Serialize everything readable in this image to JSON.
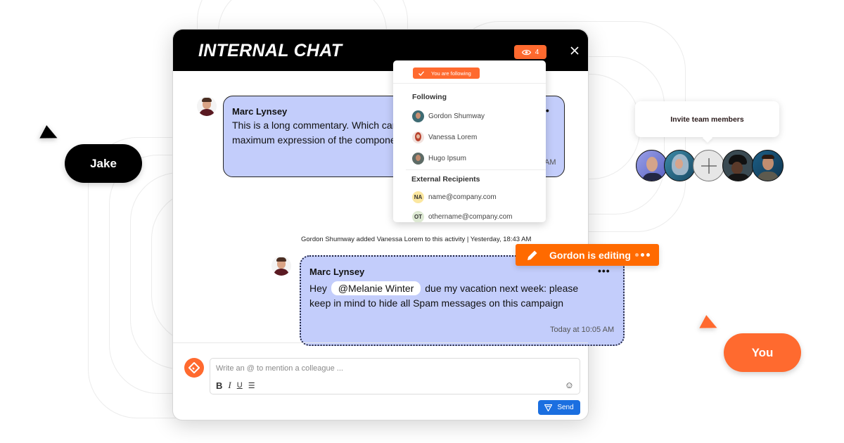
{
  "cursors": {
    "jake": {
      "label": "Jake",
      "color": "#000000"
    },
    "you": {
      "label": "You",
      "color": "#ff6a2f"
    }
  },
  "chat": {
    "title": "INTERNAL CHAT",
    "viewers_count": "4",
    "close_icon": "close-icon",
    "messages": [
      {
        "author": "Marc Lynsey",
        "text": "This is a long commentary. Which carries the maximum expression of the component.",
        "text_visible_line1": "This is a long commentary. Which carrie",
        "text_visible_line2": "maximum expression of the component.",
        "time_visible": "AM"
      },
      {
        "author": "Marc Lynsey",
        "text_prefix": "Hey",
        "mention": "@Melanie Winter",
        "text_line1_suffix": "due my vacation next week: please",
        "text_line2": "keep in mind to hide all Spam messages on this campaign",
        "time": "Today at 10:05 AM"
      }
    ],
    "activity_note": "Gordon Shumway added Vanessa Lorem to this activity | Yesterday, 18:43 AM",
    "composer": {
      "placeholder": "Write an @ to mention a colleague ...",
      "format_buttons": [
        "B",
        "I",
        "U",
        "☰"
      ],
      "emoji_icon": "☺",
      "send_label": "Send"
    }
  },
  "followers_dropdown": {
    "status_label": "You are following",
    "following_heading": "Following",
    "following": [
      {
        "name": "Gordon Shumway"
      },
      {
        "name": "Vanessa Lorem"
      },
      {
        "name": "Hugo Ipsum"
      }
    ],
    "external_heading": "External Recipients",
    "external": [
      {
        "initials": "NA",
        "email": "name@company.com",
        "color": "#fbe7a0"
      },
      {
        "initials": "OT",
        "email": "othername@company.com",
        "color": "#dde9d3"
      }
    ]
  },
  "editing_badge": {
    "label": "Gordon is editing",
    "color": "#ff6a00"
  },
  "invite": {
    "tooltip": "Invite team members"
  },
  "colors": {
    "accent": "#ff6a2f",
    "bubble": "#c3cdfb",
    "send": "#1b6fe0",
    "header": "#000000"
  }
}
